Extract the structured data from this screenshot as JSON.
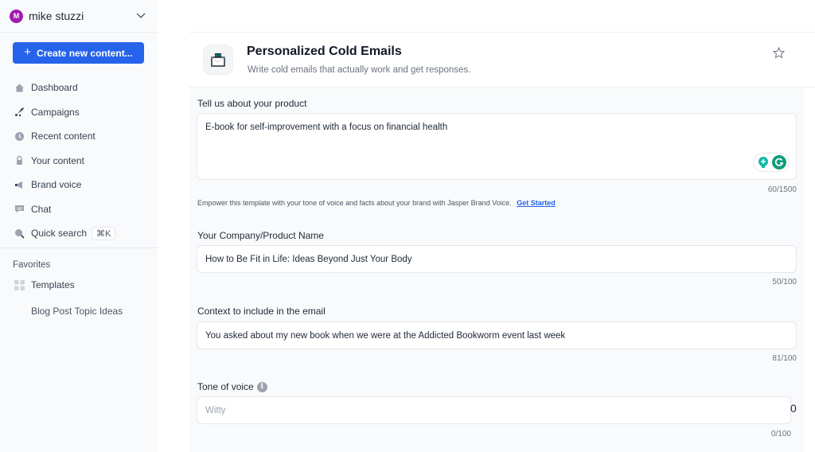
{
  "sidebar": {
    "user": {
      "initial": "M",
      "name": "mike stuzzi",
      "avatar_color": "#a21caf"
    },
    "create_button": {
      "plus": "+",
      "label": "Create new content..."
    },
    "nav": [
      {
        "icon": "home-icon",
        "label": "Dashboard"
      },
      {
        "icon": "rocket-icon",
        "label": "Campaigns"
      },
      {
        "icon": "clock-icon",
        "label": "Recent content"
      },
      {
        "icon": "lock-icon",
        "label": "Your content"
      },
      {
        "icon": "megaphone-icon",
        "label": "Brand voice"
      },
      {
        "icon": "chat-icon",
        "label": "Chat"
      },
      {
        "icon": "search-icon",
        "label": "Quick search",
        "shortcut": "⌘K"
      }
    ],
    "favorites": {
      "label": "Favorites",
      "templates_label": "Templates",
      "items": [
        "Blog Post Topic Ideas"
      ]
    }
  },
  "template": {
    "title": "Personalized Cold Emails",
    "subtitle": "Write cold emails that actually work and get responses."
  },
  "form": {
    "product": {
      "label": "Tell us about your product",
      "value": "E-book for self-improvement with a focus on financial health",
      "counter": "60/1500"
    },
    "hint": {
      "text": "Empower this template with your tone of voice and facts about your brand with Jasper Brand Voice.",
      "link": "Get Started"
    },
    "company": {
      "label": "Your Company/Product Name",
      "value": "How to Be Fit in Life: Ideas Beyond Just Your Body",
      "counter": "50/100"
    },
    "context": {
      "label": "Context to include in the email",
      "value": "You asked about my new book when we were at the Addicted Bookworm event last week",
      "counter": "81/100"
    },
    "tone": {
      "label": "Tone of voice",
      "info": "i",
      "placeholder": "Witty",
      "counter": "0/100",
      "stray_char": "0"
    }
  },
  "colors": {
    "accent": "#2563eb",
    "extension": "#0f9d7a"
  }
}
